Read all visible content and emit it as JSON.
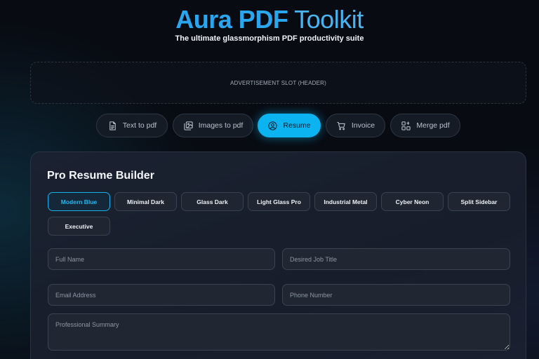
{
  "header": {
    "brand": "Aura PDF",
    "brand_suffix": " Toolkit",
    "subtitle": "The ultimate glassmorphism PDF productivity suite"
  },
  "ad_slot": {
    "label": "ADVERTISEMENT SLOT (HEADER)"
  },
  "tabs": [
    {
      "label": "Text to pdf",
      "icon": "document-icon"
    },
    {
      "label": "Images to pdf",
      "icon": "images-icon"
    },
    {
      "label": "Resume",
      "icon": "user-circle-icon",
      "active": true
    },
    {
      "label": "Invoice",
      "icon": "cart-icon"
    },
    {
      "label": "Merge pdf",
      "icon": "merge-icon"
    }
  ],
  "builder": {
    "title": "Pro Resume Builder",
    "themes": [
      "Modern Blue",
      "Minimal Dark",
      "Glass Dark",
      "Light Glass Pro",
      "Industrial Metal",
      "Cyber Neon",
      "Split Sidebar",
      "Executive"
    ],
    "selected_theme": "Modern Blue",
    "fields": {
      "full_name": "Full Name",
      "job_title": "Desired Job Title",
      "email": "Email Address",
      "phone": "Phone Number",
      "summary": "Professional Summary"
    }
  },
  "colors": {
    "accent": "#0bb4f0",
    "brand": "#2aa6ee",
    "background": "#080b12"
  }
}
